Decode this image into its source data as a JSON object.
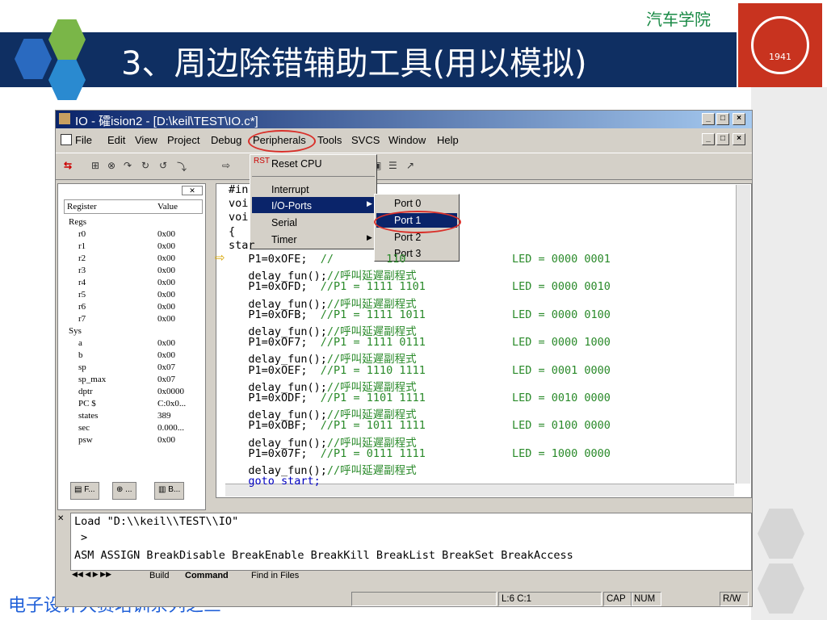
{
  "slide": {
    "brand": "汽车学院",
    "title": "3、周边除错辅助工具(用以模拟)",
    "footer": "电子设计大赛培训系列之三",
    "seal_text": "1941"
  },
  "window": {
    "title": "IO - 礭ision2 - [D:\\keil\\TEST\\IO.c*]",
    "min": "_",
    "max": "□",
    "close": "×"
  },
  "menu": {
    "file": "File",
    "edit": "Edit",
    "view": "View",
    "project": "Project",
    "debug": "Debug",
    "peripherals": "Peripherals",
    "tools": "Tools",
    "svcs": "SVCS",
    "window": "Window",
    "help": "Help"
  },
  "peripherals_menu": {
    "reset_cpu": "Reset CPU",
    "interrupt": "Interrupt",
    "io_ports": "I/O-Ports",
    "serial": "Serial",
    "timer": "Timer"
  },
  "ports_menu": [
    "Port 0",
    "Port 1",
    "Port 2",
    "Port 3"
  ],
  "registers": {
    "header_register": "Register",
    "header_value": "Value",
    "rows": [
      {
        "name": "Regs",
        "value": ""
      },
      {
        "name": "r0",
        "value": "0x00"
      },
      {
        "name": "r1",
        "value": "0x00"
      },
      {
        "name": "r2",
        "value": "0x00"
      },
      {
        "name": "r3",
        "value": "0x00"
      },
      {
        "name": "r4",
        "value": "0x00"
      },
      {
        "name": "r5",
        "value": "0x00"
      },
      {
        "name": "r6",
        "value": "0x00"
      },
      {
        "name": "r7",
        "value": "0x00"
      },
      {
        "name": "Sys",
        "value": ""
      },
      {
        "name": "a",
        "value": "0x00"
      },
      {
        "name": "b",
        "value": "0x00"
      },
      {
        "name": "sp",
        "value": "0x07"
      },
      {
        "name": "sp_max",
        "value": "0x07"
      },
      {
        "name": "dptr",
        "value": "0x0000"
      },
      {
        "name": "PC $",
        "value": "C:0x0..."
      },
      {
        "name": "states",
        "value": "389"
      },
      {
        "name": "sec",
        "value": "0.000..."
      },
      {
        "name": "psw",
        "value": "0x00"
      }
    ],
    "tabs": [
      "F...",
      "...",
      "B..."
    ]
  },
  "code": {
    "lines": [
      {
        "code": "#in",
        "comment": "",
        "led": ""
      },
      {
        "code": "voi",
        "comment": "",
        "led": ""
      },
      {
        "code": "voi",
        "comment": "",
        "led": ""
      },
      {
        "code": "{",
        "comment": "",
        "led": ""
      },
      {
        "code": "star",
        "comment": "",
        "led": ""
      },
      {
        "code": "   P1=0xOFE;",
        "comment": "  //        110",
        "led": "LED = 0000 0001"
      },
      {
        "code": "   delay_fun();",
        "comment": "//呼叫延遲副程式",
        "led": ""
      },
      {
        "code": "   P1=0xOFD;",
        "comment": "  //P1 = 1111 1101",
        "led": "LED = 0000 0010"
      },
      {
        "code": "   delay_fun();",
        "comment": "//呼叫延遲副程式",
        "led": ""
      },
      {
        "code": "   P1=0xOFB;",
        "comment": "  //P1 = 1111 1011",
        "led": "LED = 0000 0100"
      },
      {
        "code": "   delay_fun();",
        "comment": "//呼叫延遲副程式",
        "led": ""
      },
      {
        "code": "   P1=0xOF7;",
        "comment": "  //P1 = 1111 0111",
        "led": "LED = 0000 1000"
      },
      {
        "code": "   delay_fun();",
        "comment": "//呼叫延遲副程式",
        "led": ""
      },
      {
        "code": "   P1=0xOEF;",
        "comment": "  //P1 = 1110 1111",
        "led": "LED = 0001 0000"
      },
      {
        "code": "   delay_fun();",
        "comment": "//呼叫延遲副程式",
        "led": ""
      },
      {
        "code": "   P1=0xODF;",
        "comment": "  //P1 = 1101 1111",
        "led": "LED = 0010 0000"
      },
      {
        "code": "   delay_fun();",
        "comment": "//呼叫延遲副程式",
        "led": ""
      },
      {
        "code": "   P1=0xOBF;",
        "comment": "  //P1 = 1011 1111",
        "led": "LED = 0100 0000"
      },
      {
        "code": "   delay_fun();",
        "comment": "//呼叫延遲副程式",
        "led": ""
      },
      {
        "code": "   P1=0x07F;",
        "comment": "  //P1 = 0111 1111",
        "led": "LED = 1000 0000"
      },
      {
        "code": "   delay_fun();",
        "comment": "//呼叫延遲副程式",
        "led": ""
      },
      {
        "code": "   goto start;",
        "comment": "",
        "led": ""
      }
    ]
  },
  "output": {
    "line1": "Load \"D:\\\\keil\\\\TEST\\\\IO\"",
    "line2": ">",
    "line3": "ASM ASSIGN BreakDisable BreakEnable BreakKill BreakList BreakSet BreakAccess",
    "tabs": [
      "Build",
      "Command",
      "Find in Files"
    ]
  },
  "status": {
    "position": "L:6 C:1",
    "cap": "CAP",
    "num": "NUM",
    "rw": "R/W"
  },
  "colors": {
    "header_bg": "#0f2f62",
    "highlight": "#0a246a",
    "annotation": "#d9302a"
  }
}
